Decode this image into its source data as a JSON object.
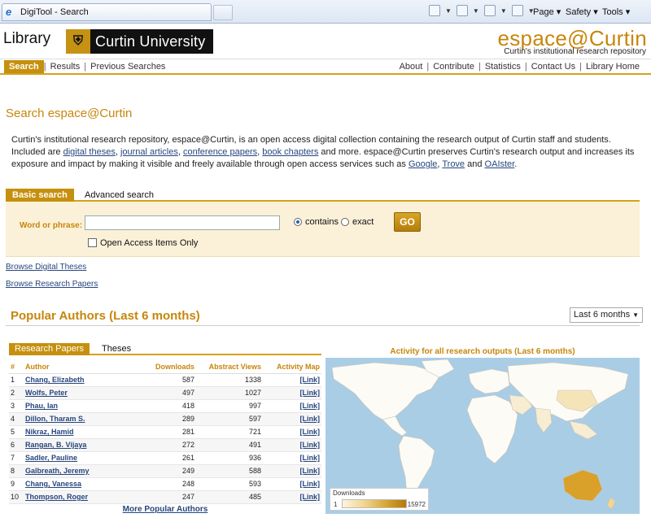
{
  "browser": {
    "tab_title": "DigiTool - Search",
    "menu_page": "Page",
    "menu_safety": "Safety",
    "menu_tools": "Tools"
  },
  "header": {
    "library_label": "Library",
    "university_name": "Curtin University",
    "site_title": "espace@Curtin",
    "site_subtitle": "Curtin's institutional research repository"
  },
  "nav": {
    "left": [
      "Search",
      "Results",
      "Previous Searches"
    ],
    "right": [
      "About",
      "Contribute",
      "Statistics",
      "Contact Us",
      "Library Home"
    ]
  },
  "page_title": "Search espace@Curtin",
  "intro": {
    "p1": "Curtin's institutional research repository, espace@Curtin, is an open access digital collection containing the research output of Curtin staff and students. Included are",
    "link_theses": "digital theses",
    "link_articles": "journal articles",
    "link_conference": "conference papers",
    "link_chapters": "book chapters",
    "p2": "and more. espace@Curtin preserves Curtin's research output and increases its exposure and impact by making it visible and freely available through open access services such as",
    "link_google": "Google",
    "link_trove": "Trove",
    "and_text": "and",
    "link_oaister": "OAIster",
    "end": "."
  },
  "search": {
    "tab_basic": "Basic search",
    "tab_advanced": "Advanced search",
    "word_label": "Word or phrase:",
    "word_value": "",
    "option_contains": "contains",
    "option_exact": "exact",
    "go_label": "GO",
    "open_access_label": "Open Access Items Only"
  },
  "browse": {
    "theses": "Browse Digital Theses",
    "papers": "Browse Research Papers"
  },
  "popular": {
    "title": "Popular Authors (Last 6 months)",
    "period_selected": "Last 6 months",
    "tab_papers": "Research Papers",
    "tab_theses": "Theses",
    "columns": [
      "#",
      "Author",
      "Downloads",
      "Abstract Views",
      "Activity Map"
    ],
    "rows": [
      {
        "n": "1",
        "author": "Chang, Elizabeth",
        "downloads": "587",
        "views": "1338",
        "map": "[Link]"
      },
      {
        "n": "2",
        "author": "Wolfs, Peter",
        "downloads": "497",
        "views": "1027",
        "map": "[Link]"
      },
      {
        "n": "3",
        "author": "Phau, Ian",
        "downloads": "418",
        "views": "997",
        "map": "[Link]"
      },
      {
        "n": "4",
        "author": "Dillon, Tharam S.",
        "downloads": "289",
        "views": "597",
        "map": "[Link]"
      },
      {
        "n": "5",
        "author": "Nikraz, Hamid",
        "downloads": "281",
        "views": "721",
        "map": "[Link]"
      },
      {
        "n": "6",
        "author": "Rangan, B. Vijaya",
        "downloads": "272",
        "views": "491",
        "map": "[Link]"
      },
      {
        "n": "7",
        "author": "Sadler, Pauline",
        "downloads": "261",
        "views": "936",
        "map": "[Link]"
      },
      {
        "n": "8",
        "author": "Galbreath, Jeremy",
        "downloads": "249",
        "views": "588",
        "map": "[Link]"
      },
      {
        "n": "9",
        "author": "Chang, Vanessa",
        "downloads": "248",
        "views": "593",
        "map": "[Link]"
      },
      {
        "n": "10",
        "author": "Thompson, Roger",
        "downloads": "247",
        "views": "485",
        "map": "[Link]"
      }
    ],
    "more_link": "More Popular Authors"
  },
  "map": {
    "caption": "Activity for all research outputs (Last 6 months)",
    "legend_title": "Downloads",
    "legend_min": "1",
    "legend_max": "15972",
    "ocean_color": "#aacde6",
    "land_color": "#fdfbf5",
    "highlight_color": "#d9a02a"
  },
  "colors": {
    "accent": "#c6900e",
    "title": "#c7860b",
    "link": "#27467d"
  }
}
